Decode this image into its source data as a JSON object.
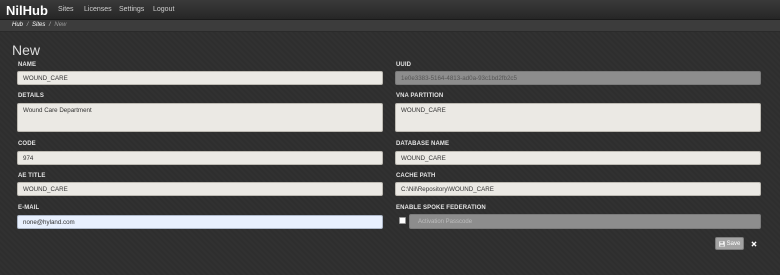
{
  "navbar": {
    "brand": "NilHub",
    "items": [
      {
        "label": "Sites"
      },
      {
        "label": "Licenses"
      },
      {
        "label": "Settings"
      },
      {
        "label": "Logout"
      }
    ]
  },
  "breadcrumb": {
    "items": [
      {
        "label": "Hub"
      },
      {
        "label": "Sites"
      },
      {
        "label": "New"
      }
    ],
    "separator": "/"
  },
  "page": {
    "title": "New"
  },
  "form": {
    "name": {
      "label": "NAME",
      "value": "WOUND_CARE"
    },
    "uuid": {
      "label": "UUID",
      "value": "1e0e3383-5164-4813-ad0a-93c1bd2fb2c5"
    },
    "details": {
      "label": "DETAILS",
      "value": "Wound Care Department"
    },
    "vna_partition": {
      "label": "VNA PARTITION",
      "value": "WOUND_CARE"
    },
    "code": {
      "label": "CODE",
      "value": "974"
    },
    "database_name": {
      "label": "DATABASE NAME",
      "value": "WOUND_CARE"
    },
    "ae_title": {
      "label": "AE TITLE",
      "value": "WOUND_CARE"
    },
    "cache_path": {
      "label": "CACHE PATH",
      "value": "C:\\Nil\\Repository\\WOUND_CARE"
    },
    "email": {
      "label": "E-MAIL",
      "value": "none@hyland.com"
    },
    "spoke_federation": {
      "label": "ENABLE SPOKE FEDERATION",
      "checked": false,
      "placeholder": "Activation Passcode"
    }
  },
  "actions": {
    "save_label": "Save",
    "close_icon": "close-icon",
    "save_icon": "floppy-disk-icon"
  },
  "colors": {
    "background": "#2f2f2f",
    "navbar": "#262626",
    "field": "#ebe9e4",
    "disabled_field": "#8d8d8d",
    "focused_field": "#e8f0fe"
  }
}
